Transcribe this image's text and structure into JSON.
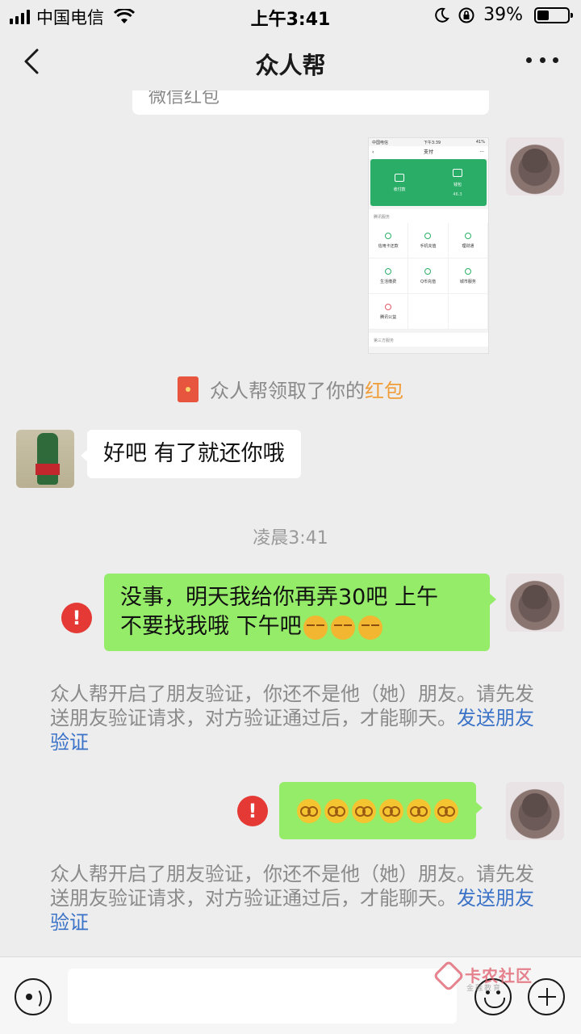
{
  "status_bar": {
    "carrier": "中国电信",
    "time": "上午3:41",
    "battery": "39%",
    "battery_level": 0.39
  },
  "nav": {
    "title": "众人帮"
  },
  "messages": {
    "prev_card_label": "微信红包",
    "image_preview": {
      "carrier": "中国电信",
      "time": "下午3:39",
      "battery": "41%",
      "title": "支付",
      "receive_pay": "收付款",
      "wallet": "钱包",
      "wallet_amount": "46.3",
      "section_tencent": "腾讯服务",
      "services": [
        "信用卡还款",
        "手机充值",
        "理财通",
        "生活缴费",
        "Q币充值",
        "城市服务",
        "腾讯公益"
      ],
      "section_third": "第三方服务"
    },
    "red_packet_notice": {
      "prefix": "众人帮领取了你的",
      "link": "红包"
    },
    "reply_1": "好吧 有了就还你哦",
    "time_label": "凌晨3:41",
    "msg_1_line1": "没事，明天我给你再弄30吧 上午",
    "msg_1_line2": "不要找我哦 下午吧",
    "error_mark": "!",
    "system_notice_1": {
      "text": "众人帮开启了朋友验证，你还不是他（她）朋友。请先发送朋友验证请求，对方验证通过后，才能聊天。",
      "link": "发送朋友验证"
    },
    "system_notice_2": {
      "text": "众人帮开启了朋友验证，你还不是他（她）朋友。请先发送朋友验证请求，对方验证通过后，才能聊天。",
      "link": "发送朋友验证"
    }
  },
  "watermark": {
    "title": "卡农社区",
    "sub": "金融教育"
  },
  "icons": {
    "back": "chevron-left-icon",
    "more": "more-dots-icon",
    "voice": "voice-icon",
    "emoji": "emoji-icon",
    "plus": "plus-icon",
    "error": "error-icon",
    "red_packet": "red-packet-icon"
  },
  "colors": {
    "green_bubble": "#95ec69",
    "error_red": "#e53935",
    "link_blue": "#3a72c8",
    "red_packet_orange": "#f09d38"
  }
}
